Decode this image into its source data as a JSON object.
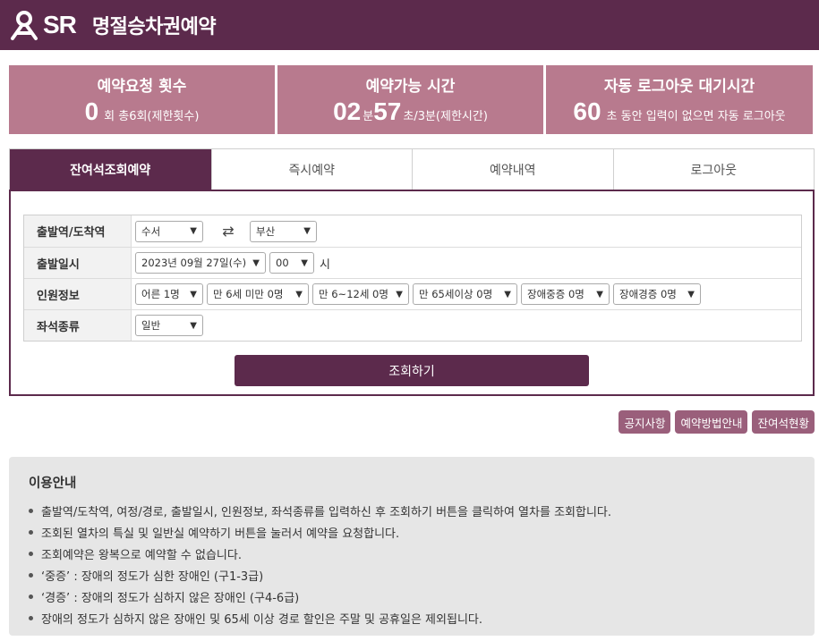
{
  "header": {
    "logo_text": "SR",
    "title": "명절승차권예약"
  },
  "stats": {
    "requests": {
      "title": "예약요청 횟수",
      "count": "0",
      "suffix": "회 총6회(제한횟수)"
    },
    "time": {
      "title": "예약가능 시간",
      "minutes": "02",
      "min_unit": "분",
      "seconds": "57",
      "suffix": "초/3분(제한시간)"
    },
    "logout": {
      "title": "자동 로그아웃 대기시간",
      "seconds": "60",
      "suffix": "초 동안 입력이 없으면 자동 로그아웃"
    }
  },
  "tabs": [
    {
      "label": "잔여석조회예약",
      "active": true
    },
    {
      "label": "즉시예약"
    },
    {
      "label": "예약내역"
    },
    {
      "label": "로그아웃"
    }
  ],
  "form": {
    "station": {
      "label": "출발역/도착역",
      "departure": "수서",
      "arrival": "부산"
    },
    "datetime": {
      "label": "출발일시",
      "date": "2023년 09월 27일(수)",
      "hour": "00",
      "hour_unit": "시"
    },
    "passengers": {
      "label": "인원정보",
      "options": [
        "어른 1명",
        "만 6세 미만 0명",
        "만 6~12세 0명",
        "만 65세이상 0명",
        "장애중증 0명",
        "장애경증 0명"
      ]
    },
    "seat": {
      "label": "좌석종류",
      "value": "일반"
    },
    "search_label": "조회하기"
  },
  "mini_buttons": [
    "공지사항",
    "예약방법안내",
    "잔여석현황"
  ],
  "info": {
    "title": "이용안내",
    "items": [
      "출발역/도착역, 여정/경로, 출발일시, 인원정보, 좌석종류를 입력하신 후 조회하기 버튼을 클릭하여 열차를 조회합니다.",
      "조회된 열차의 특실 및 일반실 예약하기 버튼을 눌러서 예약을 요청합니다.",
      "조회예약은 왕복으로 예약할 수 없습니다.",
      "‘중증’ : 장애의 정도가 심한 장애인 (구1-3급)",
      "‘경증’ : 장애의 정도가 심하지 않은 장애인 (구4-6급)",
      "장애의 정도가 심하지 않은 장애인 및 65세 이상 경로 할인은 주말 및 공휴일은 제외됩니다."
    ]
  },
  "colors": {
    "primary": "#5c2a4c",
    "stat_bg": "#b87a8e",
    "mini_button": "#9a5f7b",
    "info_bg": "#e6e6e6"
  }
}
